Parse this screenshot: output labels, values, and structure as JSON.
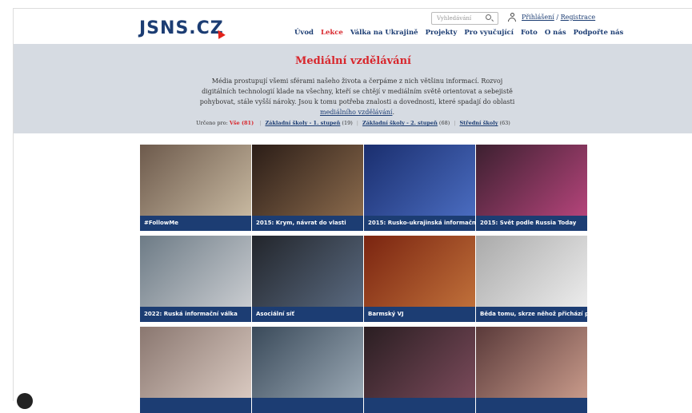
{
  "header": {
    "logo": "JSNS.CZ",
    "search_placeholder": "Vyhledávání",
    "login": "Přihlášení",
    "auth_sep": "/",
    "register": "Registrace",
    "nav": [
      "Úvod",
      "Lekce",
      "Válka na Ukrajině",
      "Projekty",
      "Pro vyučující",
      "Foto",
      "O nás",
      "Podpořte nás"
    ],
    "active_nav": "Lekce"
  },
  "hero": {
    "title": "Mediální vzdělávání",
    "text_before": "Média prostupují všemi sférami našeho života a čerpáme z nich většinu informací. Rozvoj digitálních technologií klade na všechny, kteří se chtějí v mediálním světě orientovat a sebejistě pohybovat, stále vyšší nároky. Jsou k tomu potřeba znalosti a dovednosti, které spadají do oblasti ",
    "text_link": "mediálního vzdělávání",
    "text_after": "."
  },
  "filters": {
    "label": "Určeno pro:",
    "all": "Vše (81)",
    "items": [
      {
        "label": "Základní školy - 1. stupeň",
        "count": "(19)"
      },
      {
        "label": "Základní školy - 2. stupeň",
        "count": "(68)"
      },
      {
        "label": "Střední školy",
        "count": "(63)"
      }
    ]
  },
  "lessons": [
    {
      "title": "#FollowMe",
      "c1": "#6d5a4c",
      "c2": "#c7b8a0"
    },
    {
      "title": "2015: Krym, návrat do vlasti",
      "c1": "#2b1d17",
      "c2": "#8a6a4c"
    },
    {
      "title": "2015: Rusko-ukrajinská informačn...",
      "c1": "#1a2e6e",
      "c2": "#4a6cc0"
    },
    {
      "title": "2015: Svět podle Russia Today",
      "c1": "#3c2030",
      "c2": "#b4447a"
    },
    {
      "title": "2022: Ruská informační válka",
      "c1": "#6d7b86",
      "c2": "#c9ccd0"
    },
    {
      "title": "Asociální síť",
      "c1": "#22252b",
      "c2": "#5a6a80"
    },
    {
      "title": "Barmský VJ",
      "c1": "#7a2410",
      "c2": "#c0703a"
    },
    {
      "title": "Běda tomu, skrze něhož přichází p...",
      "c1": "#aaaaaa",
      "c2": "#ececec"
    },
    {
      "title": "",
      "c1": "#8a7770",
      "c2": "#d9c9c0"
    },
    {
      "title": "",
      "c1": "#3a4a5a",
      "c2": "#9aa8b4"
    },
    {
      "title": "",
      "c1": "#2a1e22",
      "c2": "#7a4a5a"
    },
    {
      "title": "",
      "c1": "#5a3a3a",
      "c2": "#c89a8a"
    }
  ]
}
